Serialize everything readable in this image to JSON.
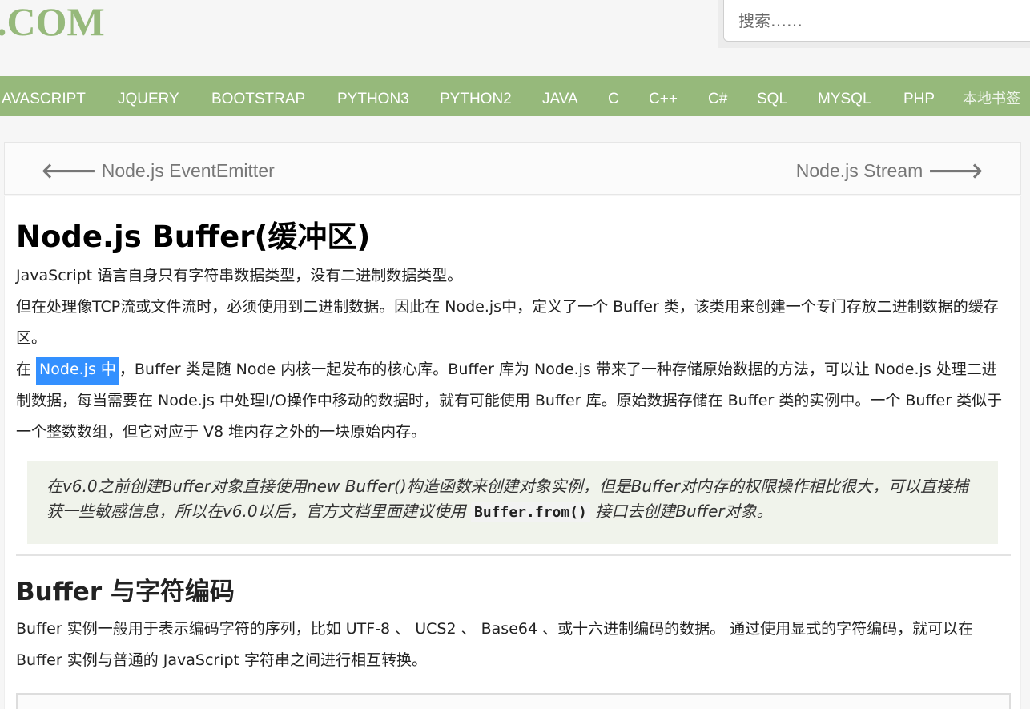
{
  "header": {
    "logo_text": ".COM",
    "search_placeholder": "搜索……"
  },
  "nav": {
    "items": [
      "AVASCRIPT",
      "JQUERY",
      "BOOTSTRAP",
      "PYTHON3",
      "PYTHON2",
      "JAVA",
      "C",
      "C++",
      "C#",
      "SQL",
      "MYSQL",
      "PHP",
      "本地书签"
    ]
  },
  "pager": {
    "prev_label": "Node.js EventEmitter",
    "next_label": "Node.js Stream"
  },
  "article": {
    "title": "Node.js Buffer(缓冲区)",
    "p1": "JavaScript 语言自身只有字符串数据类型，没有二进制数据类型。",
    "p2": "但在处理像TCP流或文件流时，必须使用到二进制数据。因此在 Node.js中，定义了一个 Buffer 类，该类用来创建一个专门存放二进制数据的缓存区。",
    "p3_prefix": "在 ",
    "p3_highlight": "Node.js 中",
    "p3_rest": "，Buffer 类是随 Node 内核一起发布的核心库。Buffer 库为 Node.js 带来了一种存储原始数据的方法，可以让 Node.js 处理二进制数据，每当需要在 Node.js 中处理I/O操作中移动的数据时，就有可能使用 Buffer 库。原始数据存储在 Buffer 类的实例中。一个 Buffer 类似于一个整数数组，但它对应于 V8 堆内存之外的一块原始内存。",
    "tip_before": "在v6.0之前创建Buffer对象直接使用new Buffer()构造函数来创建对象实例，但是Buffer对内存的权限操作相比很大，可以直接捕获一些敏感信息，所以在v6.0以后，官方文档里面建议使用 ",
    "tip_code": "Buffer.from()",
    "tip_after": " 接口去创建Buffer对象。",
    "h2": "Buffer 与字符编码",
    "p4": "Buffer 实例一般用于表示编码字符的序列，比如 UTF-8 、 UCS2 、 Base64 、或十六进制编码的数据。 通过使用显式的字符编码，就可以在 Buffer 实例与普通的 JavaScript 字符串之间进行相互转换。"
  },
  "colors": {
    "nav_bg": "#96b97b",
    "selection": "#3390ff",
    "tip_bg": "#f0f3eb"
  }
}
